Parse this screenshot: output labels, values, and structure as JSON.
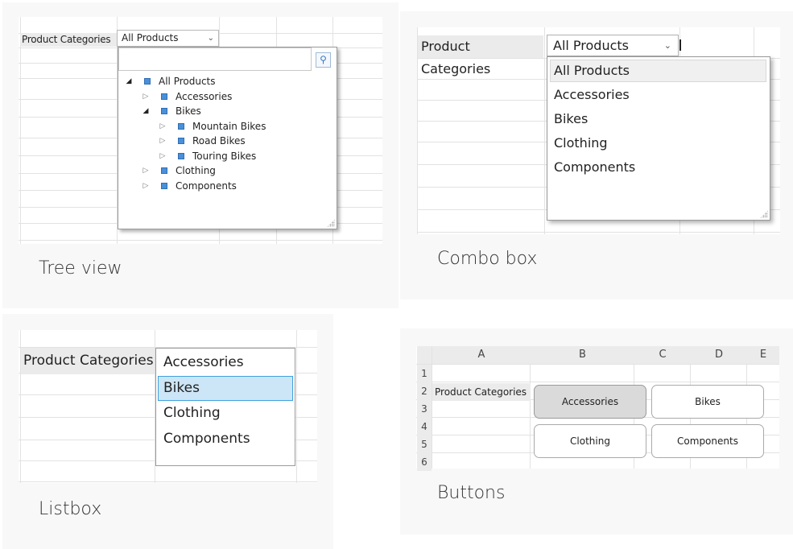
{
  "tree_view": {
    "caption": "Tree view",
    "label": "Product Categories",
    "combo_value": "All Products",
    "search_icon": "search-icon",
    "items": [
      {
        "text": "All Products",
        "level": 0,
        "expander": "open"
      },
      {
        "text": "Accessories",
        "level": 1,
        "expander": "closed"
      },
      {
        "text": "Bikes",
        "level": 1,
        "expander": "open"
      },
      {
        "text": "Mountain Bikes",
        "level": 2,
        "expander": "closed"
      },
      {
        "text": "Road Bikes",
        "level": 2,
        "expander": "closed"
      },
      {
        "text": "Touring Bikes",
        "level": 2,
        "expander": "closed"
      },
      {
        "text": "Clothing",
        "level": 1,
        "expander": "closed"
      },
      {
        "text": "Components",
        "level": 1,
        "expander": "closed"
      }
    ]
  },
  "combo_box": {
    "caption": "Combo box",
    "label": "Product Categories",
    "value": "All Products",
    "options": [
      "All Products",
      "Accessories",
      "Bikes",
      "Clothing",
      "Components"
    ],
    "selected_index": 0
  },
  "listbox": {
    "caption": "Listbox",
    "label": "Product Categories",
    "items": [
      "Accessories",
      "Bikes",
      "Clothing",
      "Components"
    ],
    "selected_index": 1,
    "selected_color": "#cde6f7",
    "selected_border": "#3ea2dd"
  },
  "buttons": {
    "caption": "Buttons",
    "columns": [
      "A",
      "B",
      "C",
      "D",
      "E"
    ],
    "rows": [
      "1",
      "2",
      "3",
      "4",
      "5",
      "6"
    ],
    "label": "Product Categories",
    "buttons": [
      {
        "text": "Accessories",
        "selected": true
      },
      {
        "text": "Bikes",
        "selected": false
      },
      {
        "text": "Clothing",
        "selected": false
      },
      {
        "text": "Components",
        "selected": false
      }
    ]
  }
}
